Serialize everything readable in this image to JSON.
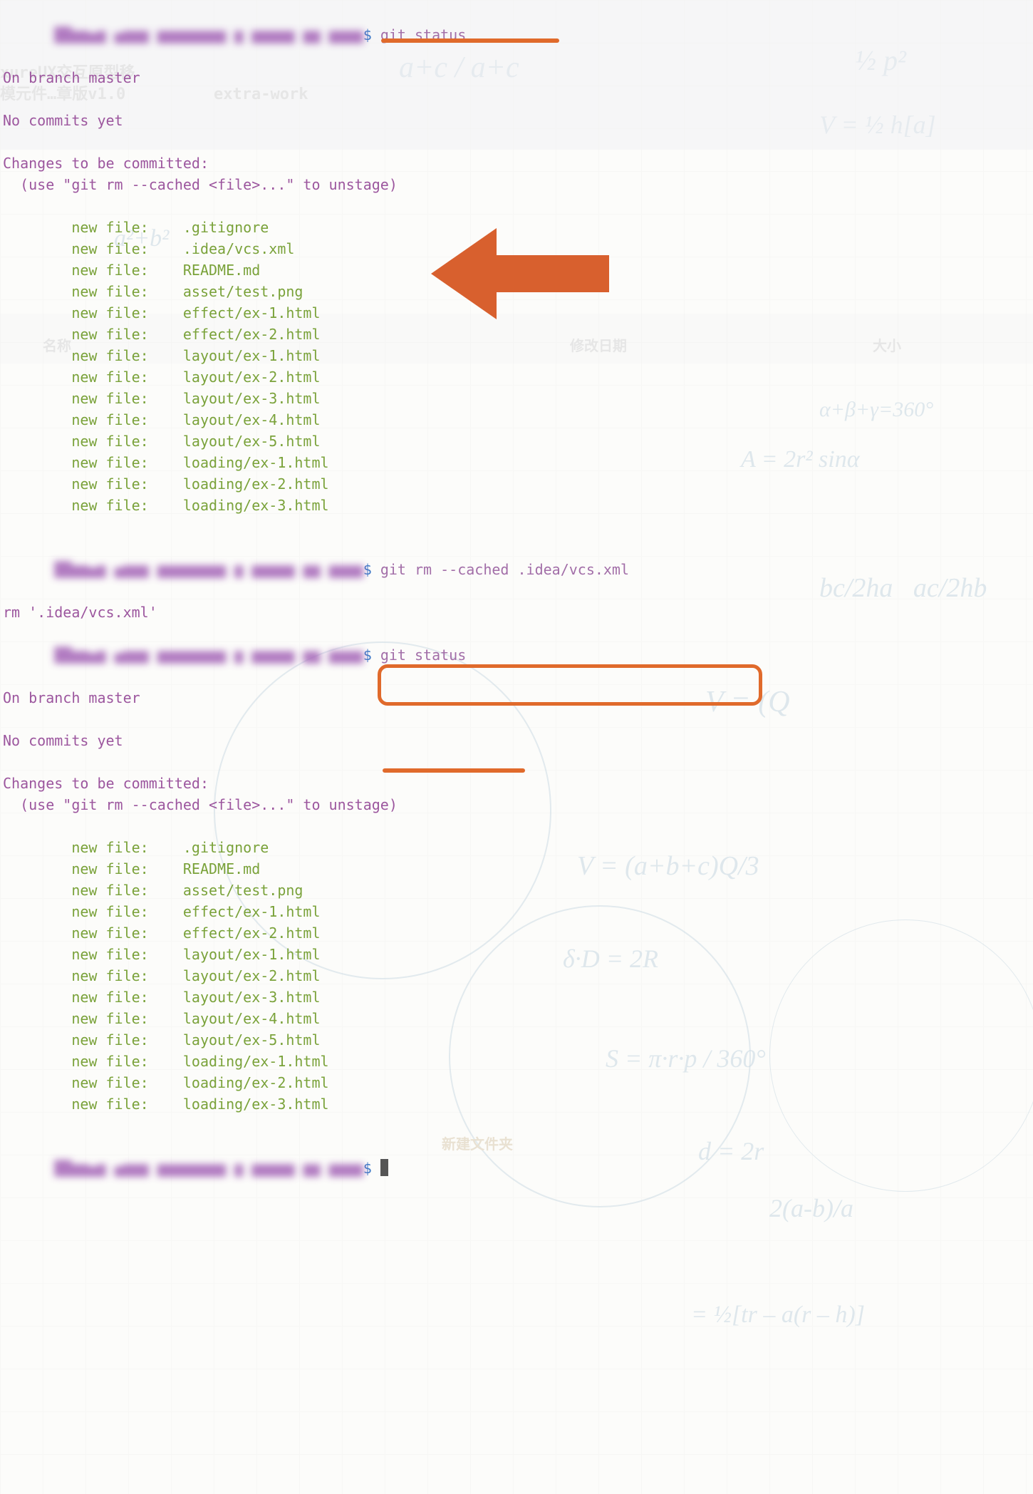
{
  "accent_orange": "#e06a2b",
  "terminal1": {
    "prompt1_cmd": "git status",
    "branch": "On branch master",
    "no_commits": "No commits yet",
    "changes_header": "Changes to be committed:",
    "unstage_hint": "  (use \"git rm --cached <file>...\" to unstage)",
    "staged": [
      {
        "label": "new file:",
        "path": ".gitignore"
      },
      {
        "label": "new file:",
        "path": ".idea/vcs.xml"
      },
      {
        "label": "new file:",
        "path": "README.md"
      },
      {
        "label": "new file:",
        "path": "asset/test.png"
      },
      {
        "label": "new file:",
        "path": "effect/ex-1.html"
      },
      {
        "label": "new file:",
        "path": "effect/ex-2.html"
      },
      {
        "label": "new file:",
        "path": "layout/ex-1.html"
      },
      {
        "label": "new file:",
        "path": "layout/ex-2.html"
      },
      {
        "label": "new file:",
        "path": "layout/ex-3.html"
      },
      {
        "label": "new file:",
        "path": "layout/ex-4.html"
      },
      {
        "label": "new file:",
        "path": "layout/ex-5.html"
      },
      {
        "label": "new file:",
        "path": "loading/ex-1.html"
      },
      {
        "label": "new file:",
        "path": "loading/ex-2.html"
      },
      {
        "label": "new file:",
        "path": "loading/ex-3.html"
      }
    ]
  },
  "command_rm": {
    "dollar1": "$",
    "cmd": "git rm --cached .idea/vcs.xml",
    "output": "rm '.idea/vcs.xml'"
  },
  "terminal2": {
    "dollar": "$",
    "cmd": "git status",
    "branch": "On branch master",
    "no_commits": "No commits yet",
    "changes_header": "Changes to be committed:",
    "unstage_hint": "  (use \"git rm --cached <file>...\" to unstage)",
    "staged": [
      {
        "label": "new file:",
        "path": ".gitignore"
      },
      {
        "label": "new file:",
        "path": "README.md"
      },
      {
        "label": "new file:",
        "path": "asset/test.png"
      },
      {
        "label": "new file:",
        "path": "effect/ex-1.html"
      },
      {
        "label": "new file:",
        "path": "effect/ex-2.html"
      },
      {
        "label": "new file:",
        "path": "layout/ex-1.html"
      },
      {
        "label": "new file:",
        "path": "layout/ex-2.html"
      },
      {
        "label": "new file:",
        "path": "layout/ex-3.html"
      },
      {
        "label": "new file:",
        "path": "layout/ex-4.html"
      },
      {
        "label": "new file:",
        "path": "layout/ex-5.html"
      },
      {
        "label": "new file:",
        "path": "loading/ex-1.html"
      },
      {
        "label": "new file:",
        "path": "loading/ex-2.html"
      },
      {
        "label": "new file:",
        "path": "loading/ex-3.html"
      }
    ]
  },
  "ghost_texts": {
    "g1": "xureUX交互原型移",
    "g2": "模元件…章版v1.0",
    "g3": "extra-work",
    "col1": "名称",
    "col2": "修改日期",
    "col3": "大小",
    "newfolder": "新建文件夹"
  }
}
